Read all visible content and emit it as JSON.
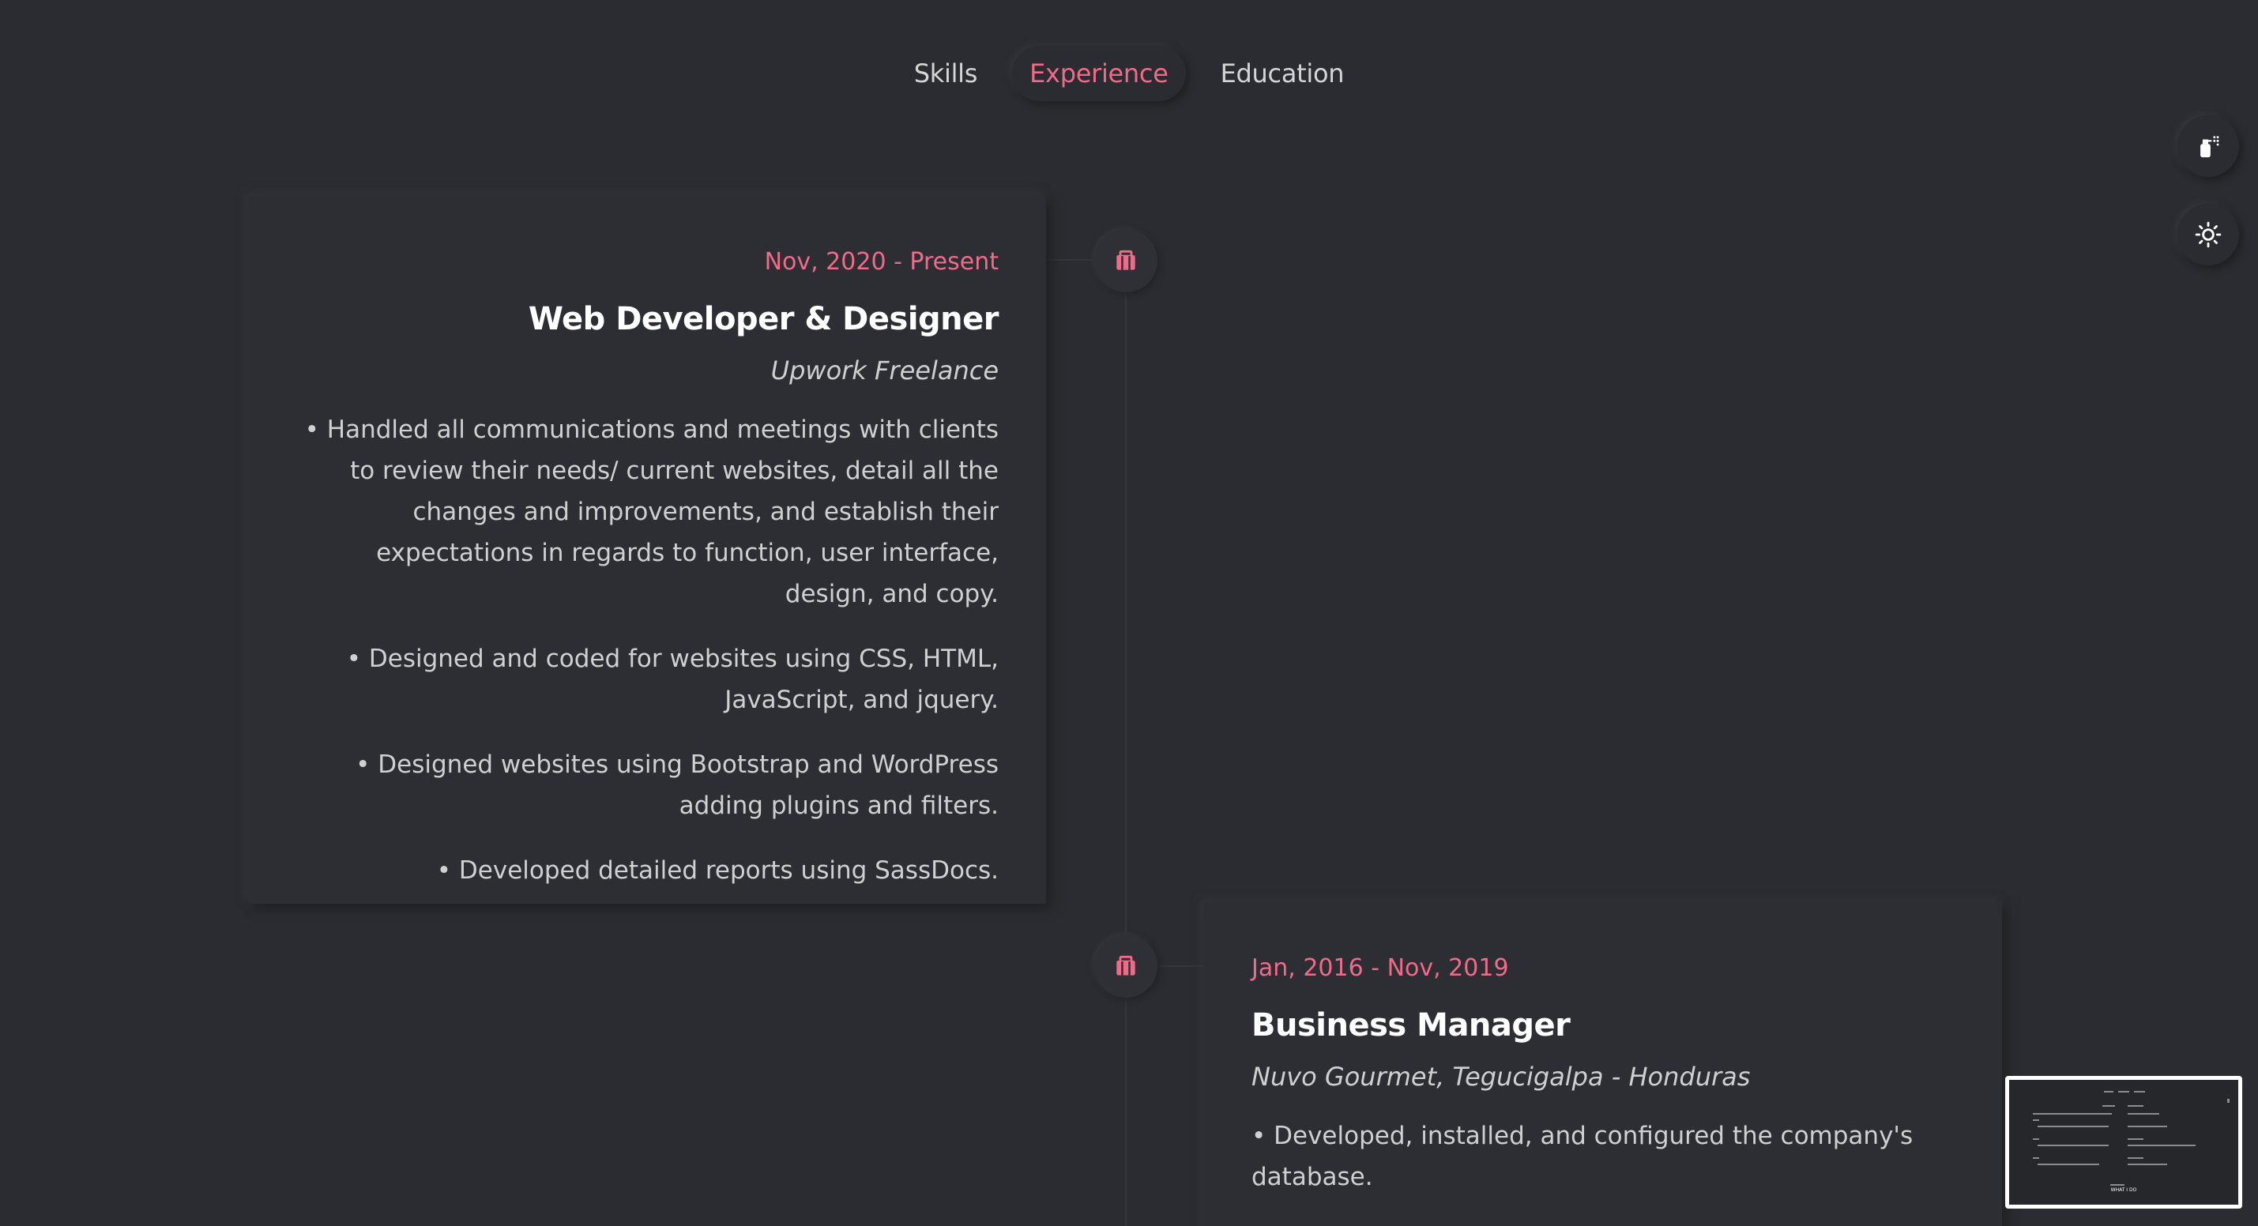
{
  "tabs": [
    {
      "label": "Skills",
      "active": false
    },
    {
      "label": "Experience",
      "active": true
    },
    {
      "label": "Education",
      "active": false
    }
  ],
  "experience": [
    {
      "date": "Nov, 2020 - Present",
      "role": "Web Developer & Designer",
      "company": "Upwork Freelance",
      "bullets": [
        "• Handled all communications and meetings with clients to review their needs/ current websites, detail all the changes and improvements, and establish their expectations in regards to function, user interface, design, and copy.",
        "• Designed and coded for websites using CSS, HTML, JavaScript, and jquery.",
        "• Designed websites using Bootstrap and WordPress adding plugins and filters.",
        "• Developed detailed reports using SassDocs."
      ]
    },
    {
      "date": "Jan, 2016 - Nov, 2019",
      "role": "Business Manager",
      "company": "Nuvo Gourmet, Tegucigalpa - Honduras",
      "bullets": [
        "• Developed, installed, and configured the company's database."
      ]
    }
  ],
  "side_buttons": [
    {
      "icon": "spray-paint-icon"
    },
    {
      "icon": "sun-icon"
    }
  ],
  "minimap": {
    "label": "WHAT I DO"
  },
  "colors": {
    "background": "#2b2c31",
    "accent": "#f06b8a",
    "card": "#2d2e33"
  }
}
